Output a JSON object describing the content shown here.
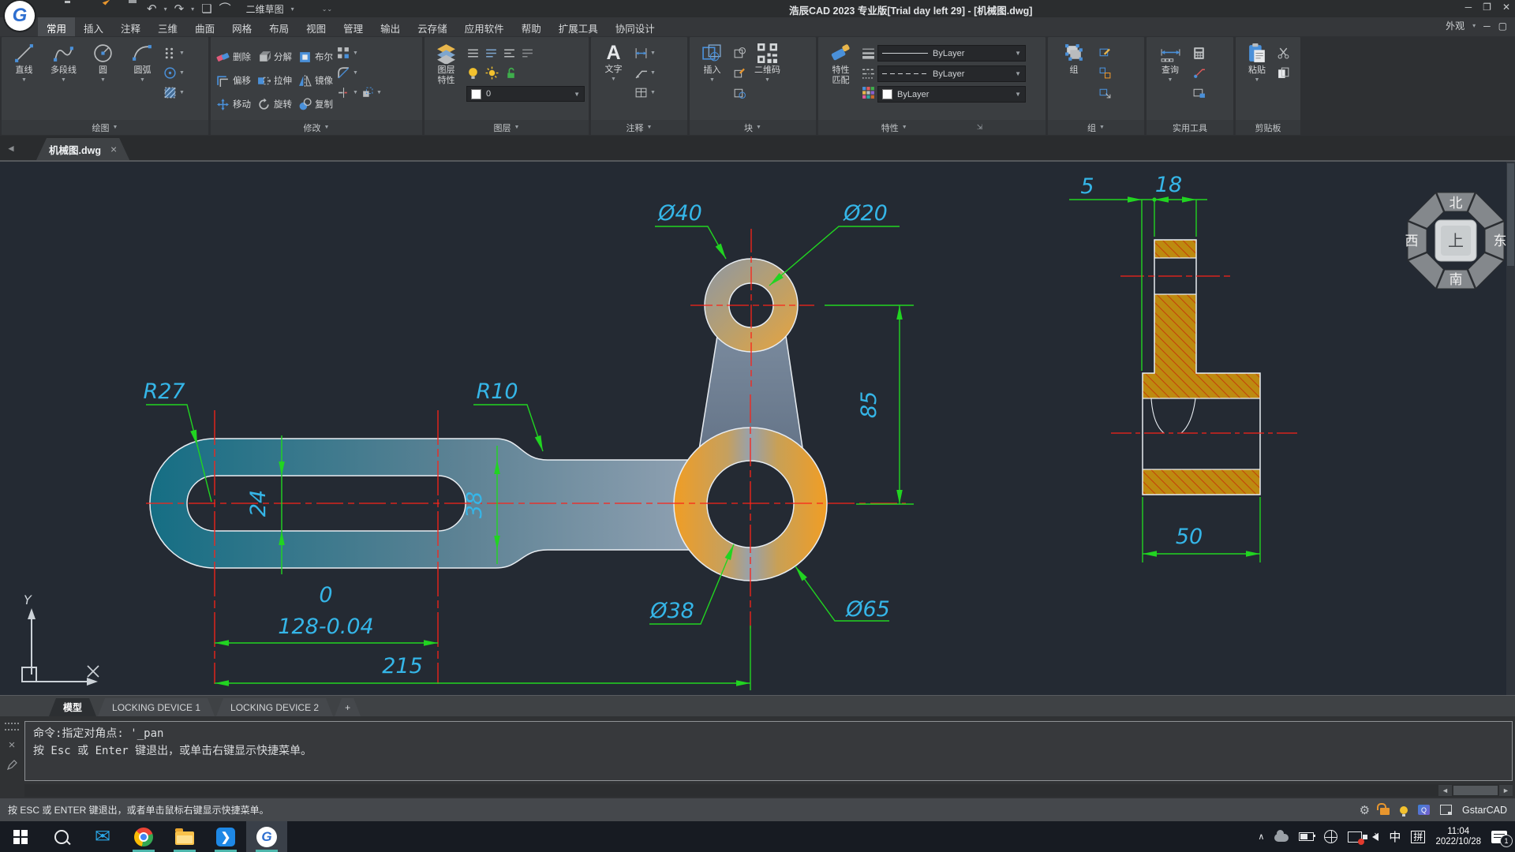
{
  "window": {
    "title": "浩辰CAD 2023 专业版[Trial day left 29] - [机械图.dwg]",
    "workspace": "二维草图",
    "logo_letter": "G",
    "minimize": "─",
    "maximize": "❐",
    "close": "✕"
  },
  "menu": {
    "tabs": [
      "常用",
      "插入",
      "注释",
      "三维",
      "曲面",
      "网格",
      "布局",
      "视图",
      "管理",
      "输出",
      "云存储",
      "应用软件",
      "帮助",
      "扩展工具",
      "协同设计"
    ],
    "appearance": "外观"
  },
  "ribbon": {
    "draw": {
      "label": "绘图",
      "line": "直线",
      "polyline": "多段线",
      "circle": "圆",
      "arc": "圆弧"
    },
    "modify": {
      "label": "修改",
      "erase": "删除",
      "explode": "分解",
      "boolean": "布尔",
      "offset": "偏移",
      "stretch": "拉伸",
      "mirror": "镜像",
      "move": "移动",
      "rotate": "旋转",
      "copy": "复制"
    },
    "layers": {
      "label": "图层",
      "properties": "图层\n特性",
      "current_layer": "0"
    },
    "annotation": {
      "label": "注释",
      "text": "文字",
      "a_glyph": "A"
    },
    "block": {
      "label": "块",
      "insert": "插入",
      "qrcode": "二维码"
    },
    "properties": {
      "label": "特性",
      "match": "特性\n匹配",
      "linetype": "ByLayer",
      "lineweight": "ByLayer",
      "color": "ByLayer"
    },
    "group": {
      "label": "组",
      "group": "组"
    },
    "utilities": {
      "label": "实用工具",
      "inquiry": "查询"
    },
    "clipboard": {
      "label": "剪贴板",
      "paste": "粘贴"
    }
  },
  "filetab": {
    "name": "机械图.dwg",
    "close": "×",
    "back": "◄"
  },
  "drawing": {
    "dims": {
      "r27": "R27",
      "r10": "R10",
      "w24": "24",
      "w38": "38",
      "d0": "0",
      "d128": "128-0.04",
      "d215": "215",
      "d40": "Ø40",
      "d20": "Ø20",
      "h85": "85",
      "d38": "Ø38",
      "d65": "Ø65",
      "s5": "5",
      "s18": "18",
      "s50": "50"
    },
    "compass": {
      "north": "北",
      "south": "南",
      "east": "东",
      "west": "西",
      "center": "上"
    },
    "ucs": {
      "y_label": "Y"
    },
    "colors": {
      "dimension_line": "#21d421",
      "dimension_text": "#35b6e8",
      "centerline": "#fb2318",
      "hatch_fill": "#bd8a10",
      "hatch_line": "#c63608",
      "part_teal": "#1a7387",
      "part_orange": "#ef9d26"
    }
  },
  "layout_tabs": {
    "model": "模型",
    "device1": "LOCKING DEVICE 1",
    "device2": "LOCKING DEVICE 2",
    "add": "+"
  },
  "command": {
    "line1": "命令:指定对角点: '_pan",
    "line2": "按 Esc 或 Enter 键退出，或单击右键显示快捷菜单。",
    "left_arrow": "◄",
    "right_arrow": "►",
    "close": "×"
  },
  "statusbar": {
    "hint": "按 ESC 或 ENTER 键退出，或者单击鼠标右键显示快捷菜单。",
    "brand": "GstarCAD"
  },
  "taskbar": {
    "ime_lang": "中",
    "ime_mode": "拼",
    "time": "11:04",
    "date": "2022/10/28",
    "badge": "1",
    "chevron": "∧",
    "ding": "❯"
  }
}
